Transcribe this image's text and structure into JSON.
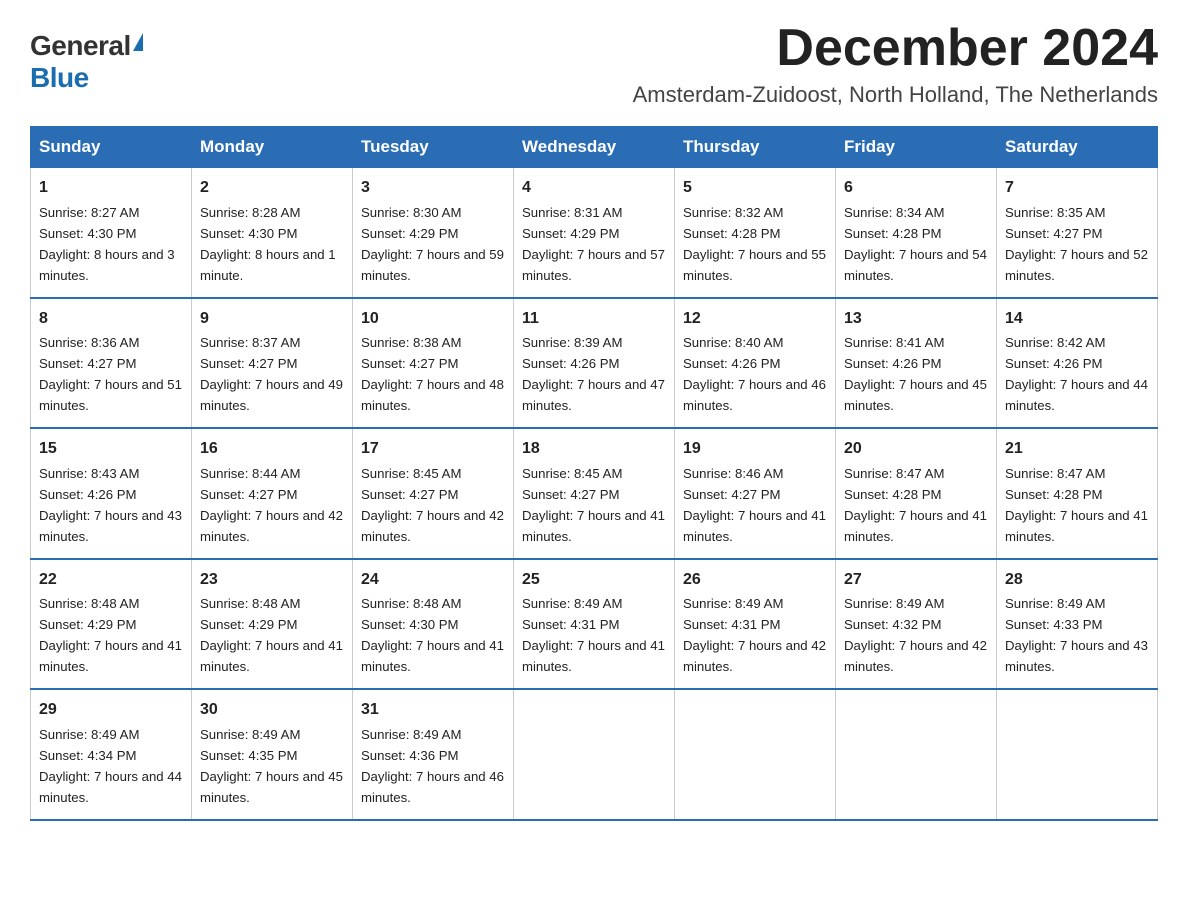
{
  "logo": {
    "general": "General",
    "blue": "Blue"
  },
  "title": {
    "month_year": "December 2024",
    "location": "Amsterdam-Zuidoost, North Holland, The Netherlands"
  },
  "weekdays": [
    "Sunday",
    "Monday",
    "Tuesday",
    "Wednesday",
    "Thursday",
    "Friday",
    "Saturday"
  ],
  "weeks": [
    [
      {
        "day": "1",
        "sunrise": "8:27 AM",
        "sunset": "4:30 PM",
        "daylight": "8 hours and 3 minutes."
      },
      {
        "day": "2",
        "sunrise": "8:28 AM",
        "sunset": "4:30 PM",
        "daylight": "8 hours and 1 minute."
      },
      {
        "day": "3",
        "sunrise": "8:30 AM",
        "sunset": "4:29 PM",
        "daylight": "7 hours and 59 minutes."
      },
      {
        "day": "4",
        "sunrise": "8:31 AM",
        "sunset": "4:29 PM",
        "daylight": "7 hours and 57 minutes."
      },
      {
        "day": "5",
        "sunrise": "8:32 AM",
        "sunset": "4:28 PM",
        "daylight": "7 hours and 55 minutes."
      },
      {
        "day": "6",
        "sunrise": "8:34 AM",
        "sunset": "4:28 PM",
        "daylight": "7 hours and 54 minutes."
      },
      {
        "day": "7",
        "sunrise": "8:35 AM",
        "sunset": "4:27 PM",
        "daylight": "7 hours and 52 minutes."
      }
    ],
    [
      {
        "day": "8",
        "sunrise": "8:36 AM",
        "sunset": "4:27 PM",
        "daylight": "7 hours and 51 minutes."
      },
      {
        "day": "9",
        "sunrise": "8:37 AM",
        "sunset": "4:27 PM",
        "daylight": "7 hours and 49 minutes."
      },
      {
        "day": "10",
        "sunrise": "8:38 AM",
        "sunset": "4:27 PM",
        "daylight": "7 hours and 48 minutes."
      },
      {
        "day": "11",
        "sunrise": "8:39 AM",
        "sunset": "4:26 PM",
        "daylight": "7 hours and 47 minutes."
      },
      {
        "day": "12",
        "sunrise": "8:40 AM",
        "sunset": "4:26 PM",
        "daylight": "7 hours and 46 minutes."
      },
      {
        "day": "13",
        "sunrise": "8:41 AM",
        "sunset": "4:26 PM",
        "daylight": "7 hours and 45 minutes."
      },
      {
        "day": "14",
        "sunrise": "8:42 AM",
        "sunset": "4:26 PM",
        "daylight": "7 hours and 44 minutes."
      }
    ],
    [
      {
        "day": "15",
        "sunrise": "8:43 AM",
        "sunset": "4:26 PM",
        "daylight": "7 hours and 43 minutes."
      },
      {
        "day": "16",
        "sunrise": "8:44 AM",
        "sunset": "4:27 PM",
        "daylight": "7 hours and 42 minutes."
      },
      {
        "day": "17",
        "sunrise": "8:45 AM",
        "sunset": "4:27 PM",
        "daylight": "7 hours and 42 minutes."
      },
      {
        "day": "18",
        "sunrise": "8:45 AM",
        "sunset": "4:27 PM",
        "daylight": "7 hours and 41 minutes."
      },
      {
        "day": "19",
        "sunrise": "8:46 AM",
        "sunset": "4:27 PM",
        "daylight": "7 hours and 41 minutes."
      },
      {
        "day": "20",
        "sunrise": "8:47 AM",
        "sunset": "4:28 PM",
        "daylight": "7 hours and 41 minutes."
      },
      {
        "day": "21",
        "sunrise": "8:47 AM",
        "sunset": "4:28 PM",
        "daylight": "7 hours and 41 minutes."
      }
    ],
    [
      {
        "day": "22",
        "sunrise": "8:48 AM",
        "sunset": "4:29 PM",
        "daylight": "7 hours and 41 minutes."
      },
      {
        "day": "23",
        "sunrise": "8:48 AM",
        "sunset": "4:29 PM",
        "daylight": "7 hours and 41 minutes."
      },
      {
        "day": "24",
        "sunrise": "8:48 AM",
        "sunset": "4:30 PM",
        "daylight": "7 hours and 41 minutes."
      },
      {
        "day": "25",
        "sunrise": "8:49 AM",
        "sunset": "4:31 PM",
        "daylight": "7 hours and 41 minutes."
      },
      {
        "day": "26",
        "sunrise": "8:49 AM",
        "sunset": "4:31 PM",
        "daylight": "7 hours and 42 minutes."
      },
      {
        "day": "27",
        "sunrise": "8:49 AM",
        "sunset": "4:32 PM",
        "daylight": "7 hours and 42 minutes."
      },
      {
        "day": "28",
        "sunrise": "8:49 AM",
        "sunset": "4:33 PM",
        "daylight": "7 hours and 43 minutes."
      }
    ],
    [
      {
        "day": "29",
        "sunrise": "8:49 AM",
        "sunset": "4:34 PM",
        "daylight": "7 hours and 44 minutes."
      },
      {
        "day": "30",
        "sunrise": "8:49 AM",
        "sunset": "4:35 PM",
        "daylight": "7 hours and 45 minutes."
      },
      {
        "day": "31",
        "sunrise": "8:49 AM",
        "sunset": "4:36 PM",
        "daylight": "7 hours and 46 minutes."
      },
      null,
      null,
      null,
      null
    ]
  ]
}
